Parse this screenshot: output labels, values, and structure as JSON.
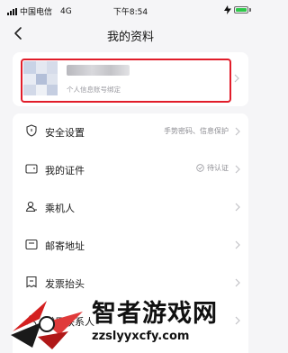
{
  "status_bar": {
    "carrier": "中国电信",
    "network": "4G",
    "time": "下午8:54"
  },
  "header": {
    "title": "我的资料",
    "back_icon": "chevron-left-icon"
  },
  "profile": {
    "hint": "个人信息账号绑定"
  },
  "menu": [
    {
      "label": "安全设置",
      "value": "手势密码、信息保护",
      "icon": "shield-icon"
    },
    {
      "label": "我的证件",
      "value": "待认证",
      "icon": "id-card-icon"
    },
    {
      "label": "乘机人",
      "value": "",
      "icon": "person-icon"
    },
    {
      "label": "邮寄地址",
      "value": "",
      "icon": "mail-icon"
    },
    {
      "label": "发票抬头",
      "value": "",
      "icon": "receipt-icon"
    },
    {
      "label": "常用联系人",
      "value": "",
      "icon": "contacts-icon"
    }
  ],
  "watermark": {
    "title": "智者游戏网",
    "url": "zzslyyxcfy.com"
  },
  "colors": {
    "highlight": "#e11d2a",
    "battery": "#2ec84a"
  }
}
